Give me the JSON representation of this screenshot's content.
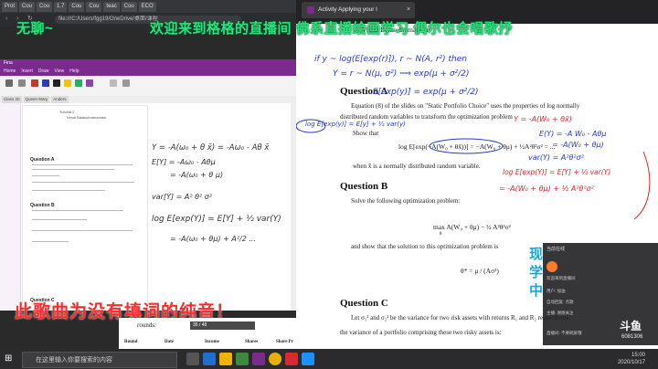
{
  "left_browser": {
    "tabs": [
      "Prot",
      "Cou",
      "Cou",
      "1.7",
      "Cou",
      "Cou",
      "teac",
      "Cou",
      "ECO"
    ],
    "address": "file:///C:/Users/fgg19/OneDrive/桌面/课程"
  },
  "onenote": {
    "title": "Fina",
    "menu": [
      "Home",
      "Insert",
      "Draw",
      "View",
      "Help"
    ],
    "tabs": [
      "Class 20",
      "Queen Mary",
      "Anders"
    ],
    "doc_header": "Tutorial 2",
    "doc_author": "Vimal Balasubramaniam",
    "q_a": "Question A",
    "q_b": "Question B",
    "q_c": "Question C",
    "handwriting": [
      "Y = -A(ω₀ + θ x̃) = -Aω₀ - Aθ x̃",
      "E[Y] = -Aω₀ - Aθμ",
      "= -A(ω₀ + θ μ)",
      "var[Y] = A² θ² σ²",
      "log E[exp(Y)] = E[Y] + ½ var(Y)",
      "= -A(ω₀ + θμ) + A²/2 ..."
    ]
  },
  "subtitle_bottom": "此歌曲为没有填词的纯音！",
  "stream_overlay": {
    "left_text": "无聊~",
    "right_text": "欢迎来到格格的直播间   佛系直播绘画学习 偶尔也会唱歌抒",
    "side_text": "现学中"
  },
  "right_browser": {
    "tab_title": "Activity Applying your l",
    "author": "Vimal Balasubramaniam",
    "question_a": "Question A",
    "qa_text1": "Equation (8) of the slides on \"Static Portfolio Choice\" uses the properties of log normally",
    "qa_text2": "distributed random variables to transform the optimization problem",
    "show_that": "Show that",
    "eq1": "log E[exp(−A(W₀ + θx̃))] = −A(W₀ + θμ) + ½A²θ²σ² = ...",
    "where_text": "when x̃ is a normally distributed random variable.",
    "question_b": "Question B",
    "qb_text": "Solve the following optimization problem:",
    "eq2": "max A(W₀ + θμ) − ½ A²θ²σ²",
    "eq2_sub": "θ",
    "and_show": "and show that the solution to this optimization problem is",
    "eq3": "θ* = μ / (Aσ²)",
    "question_c": "Question C",
    "qc_text": "Let σ₁² and σ₂² be the variance for two risk assets with returns R₁ and R₂ respectively.",
    "qc_text2": "the variance of a portfolio comprising these two risky assets is:",
    "table_headers": [
      "Round",
      "Date",
      "Income",
      "Shares",
      "Share Pr"
    ],
    "rounds_label": "rounds:",
    "annotations_blue": [
      "if y ~ log(E[exp(r)]), r ~ N(A, r²) then",
      "Y = r ~ N(μ, σ²) ⟹ exp(μ + σ²/2)",
      "E[exp(y)] = exp(μ + σ²/2)",
      "log E[exp(y)] = E[y] + ½ var(y)",
      "Y = -A(W₀ + θx̃)",
      "E(Y) = -A W₀ - Aθμ",
      "= -A(W₀ + θμ)",
      "var(Y) = A²θ²σ²"
    ],
    "annotations_red": [
      "log E[exp(Y)] = E[Y] + ½ var(Y)",
      "= -A(W₀ + θμ) + ½ A²θ²σ²"
    ]
  },
  "chat": {
    "header": "当前在线",
    "lines": [
      "欢迎来到直播间",
      "用户: 加油",
      "自动回复: 点歌",
      "主播: 谢谢关注",
      "直播间: 不要刷屏哦"
    ],
    "brand": "斗鱼",
    "room_id": "6081306"
  },
  "taskbar": {
    "search_placeholder": "在这里输入你要搜索的内容",
    "time": "15:00",
    "date": "2020/10/17"
  },
  "colors": {
    "onenote_purple": "#7b2a8e",
    "overlay_green": "#27e37e",
    "ink_blue": "#2a3bbf",
    "ink_red": "#d9282f",
    "subtitle_red": "#ff2a2a"
  }
}
